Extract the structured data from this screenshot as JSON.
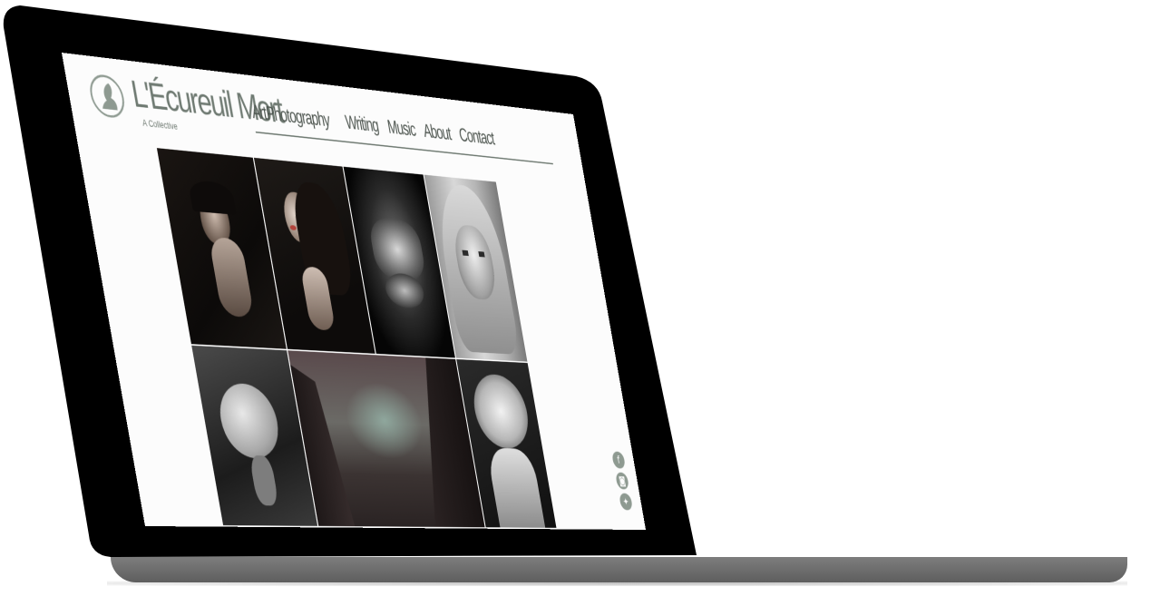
{
  "site": {
    "title": "L'Écureuil Mort",
    "subtitle": "A Collective"
  },
  "nav": {
    "items": [
      {
        "label": "Art"
      },
      {
        "label": "Photography"
      },
      {
        "label": "Writing"
      },
      {
        "label": "Music"
      },
      {
        "label": "About"
      },
      {
        "label": "Contact"
      }
    ],
    "active": "Photography"
  },
  "gallery": {
    "photos": [
      {
        "subject": "woman-hands-over-mouth",
        "tone": "dark"
      },
      {
        "subject": "woman-profile-red-lips",
        "tone": "dark"
      },
      {
        "subject": "face-covered-by-hands",
        "tone": "monochrome"
      },
      {
        "subject": "blonde-woman-portrait",
        "tone": "monochrome"
      },
      {
        "subject": "full-moon-forest",
        "tone": "monochrome"
      },
      {
        "subject": "misty-pine-forest",
        "tone": "muted"
      },
      {
        "subject": "flowers-head-portrait",
        "tone": "monochrome"
      }
    ]
  },
  "social": {
    "icons": [
      "facebook-icon",
      "instagram-icon",
      "twitter-icon"
    ]
  },
  "colors": {
    "accent": "#8e9a91",
    "text": "#4b534d",
    "screen_bg": "#fcfcfc",
    "bezel": "#000000"
  }
}
